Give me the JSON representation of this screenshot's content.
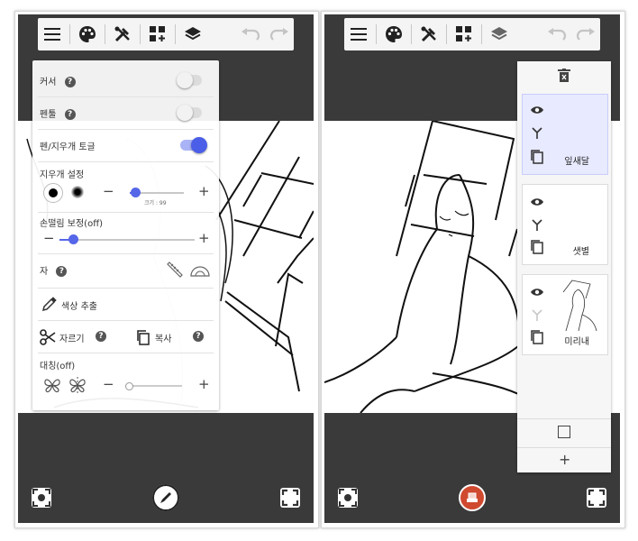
{
  "toolbar": {
    "icons": [
      "menu-icon",
      "palette-icon",
      "tools-icon",
      "add-grid-icon",
      "layers-icon",
      "undo-icon",
      "redo-icon"
    ]
  },
  "settings_panel": {
    "cursor_label": "커서",
    "pen_tool_label": "펜툴",
    "pen_eraser_toggle_label": "펜/지우개 토글",
    "pen_eraser_toggle_on": true,
    "eraser_settings_label": "지우개 설정",
    "eraser_size_text": "크기 : 99",
    "eraser_size_value": 0.1,
    "stabilizer_label": "손떨림 보정(off)",
    "stabilizer_value": 0.1,
    "ruler_label": "자",
    "color_picker_label": "색상 추출",
    "cut_label": "자르기",
    "copy_label": "복사",
    "symmetry_label": "대칭(off)",
    "symmetry_value": 0.0,
    "help_glyph": "?",
    "minus": "−",
    "plus": "+"
  },
  "layers_panel": {
    "layers": [
      {
        "name": "잎새달",
        "active": true
      },
      {
        "name": "샛별",
        "active": false
      },
      {
        "name": "미리내",
        "active": false
      }
    ],
    "add_label": "+"
  },
  "colors": {
    "accent": "#4a5ee8",
    "dark_bg": "#3a3a3a",
    "eraser_fab": "#d04a2f"
  }
}
